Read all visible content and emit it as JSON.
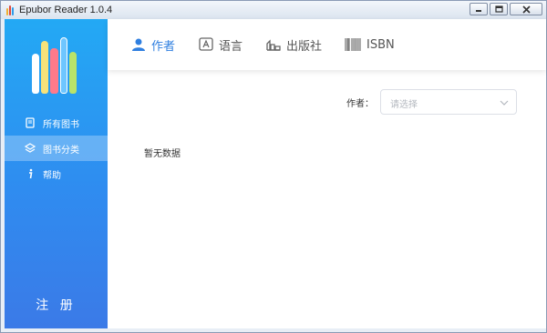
{
  "window": {
    "title": "Epubor Reader 1.0.4",
    "controls": {
      "minimize_icon": "minimize-icon",
      "restore_icon": "restore-icon",
      "close_icon": "close-icon"
    }
  },
  "colors": {
    "accent": "#2f7fe0",
    "sidebar_top": "#23a9f4",
    "sidebar_bottom": "#3b7ae7"
  },
  "sidebar": {
    "logo_icon": "books-logo",
    "items": [
      {
        "label": "所有图书",
        "icon": "book-icon",
        "active": false
      },
      {
        "label": "图书分类",
        "icon": "layers-icon",
        "active": true
      },
      {
        "label": "帮助",
        "icon": "info-icon",
        "active": false
      }
    ],
    "register_label": "注 册"
  },
  "tabs": [
    {
      "label": "作者",
      "icon": "person-icon",
      "active": true
    },
    {
      "label": "语言",
      "icon": "language-icon",
      "active": false
    },
    {
      "label": "出版社",
      "icon": "publisher-icon",
      "active": false
    },
    {
      "label": "ISBN",
      "icon": "barcode-icon",
      "active": false
    }
  ],
  "filter": {
    "label": "作者：",
    "placeholder": "请选择"
  },
  "empty_text": "暂无数据"
}
